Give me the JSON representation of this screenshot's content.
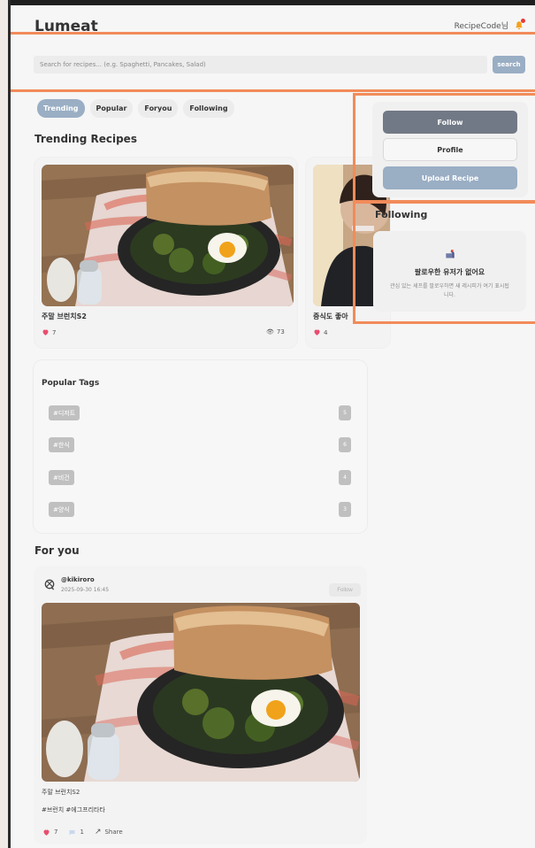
{
  "header": {
    "logo": "Lumeat",
    "user_name": "RecipeCode님"
  },
  "search": {
    "placeholder": "Search for recipes... (e.g. Spaghetti, Pancakes, Salad)",
    "button": "search"
  },
  "tabs": [
    {
      "label": "Trending",
      "active": true
    },
    {
      "label": "Popular",
      "active": false
    },
    {
      "label": "Foryou",
      "active": false
    },
    {
      "label": "Following",
      "active": false
    }
  ],
  "trending": {
    "title": "Trending Recipes",
    "cards": [
      {
        "title": "주말 브런치S2",
        "likes": "7",
        "views": "73"
      },
      {
        "title": "중식도 좋아",
        "likes": "4"
      }
    ]
  },
  "sidebar": {
    "follow": "Follow",
    "profile": "Profile",
    "upload": "Upload Recipe",
    "following_title": "Following",
    "empty_title": "팔로우한 유저가 없어요",
    "empty_desc": "관심 있는 셰프를 팔로우하면 새 레시피가 여기 표시됩니다."
  },
  "popular_tags": {
    "title": "Popular Tags",
    "items": [
      {
        "tag": "#디저트",
        "count": "5"
      },
      {
        "tag": "#한식",
        "count": "6"
      },
      {
        "tag": "#비건",
        "count": "4"
      },
      {
        "tag": "#양식",
        "count": "3"
      }
    ]
  },
  "for_you": {
    "title": "For you",
    "post": {
      "user": "@kikiroro",
      "date": "2025-09-30 16:45",
      "follow": "Follow",
      "title": "주말 브런치S2",
      "tags": "#브런치 #에그프리타타",
      "likes": "7",
      "comments": "1",
      "share": "Share"
    }
  }
}
